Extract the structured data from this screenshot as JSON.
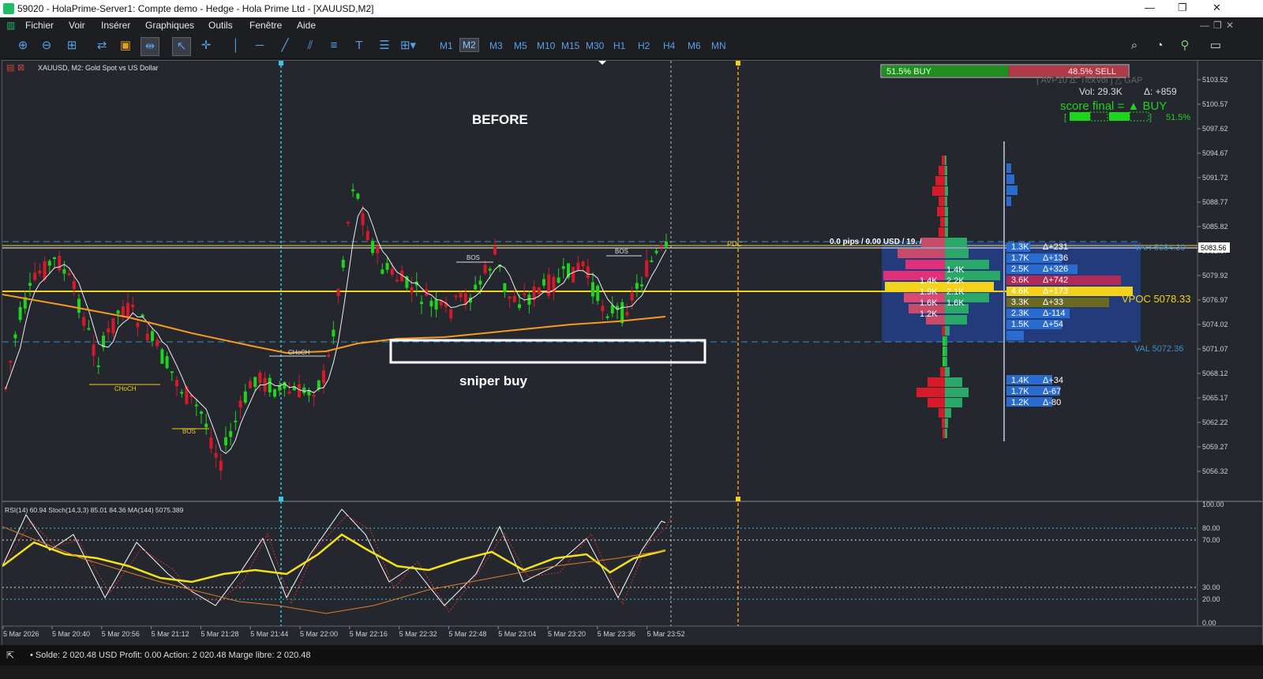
{
  "window": {
    "title": "59020 - HolaPrime-Server1: Compte demo - Hedge - Hola Prime Ltd - [XAUUSD,M2]"
  },
  "menu": [
    "Fichier",
    "Voir",
    "Insérer",
    "Graphiques",
    "Outils",
    "Fenêtre",
    "Aide"
  ],
  "timeframes": [
    "M1",
    "M2",
    "M3",
    "M5",
    "M10",
    "M15",
    "M30",
    "H1",
    "H2",
    "H4",
    "M6",
    "MN"
  ],
  "active_timeframe": "M2",
  "chart": {
    "symbol_label": "XAUUSD, M2:  Gold Spot vs US Dollar",
    "annotation_before": "BEFORE",
    "annotation_sniper": "sniper buy",
    "pips_line": "0.0 pips / 0.00 USD / 19. / 0:47:0:18",
    "pdc": "PDC",
    "markers": [
      "BOS",
      "BOS",
      "BOS",
      "CHoCH",
      "CHoCH"
    ],
    "vah": "VAH 5084.30",
    "vpoc": "VPOC 5078.33",
    "val": "VAL 5072.36",
    "current_price": "5083.56"
  },
  "price_axis": [
    "5103.52",
    "5100.57",
    "5097.62",
    "5094.67",
    "5091.72",
    "5088.77",
    "5085.82",
    "5082.87",
    "5079.92",
    "5076.97",
    "5074.02",
    "5071.07",
    "5068.12",
    "5065.17",
    "5062.22",
    "5059.27",
    "5056.32"
  ],
  "time_axis": [
    "5 Mar 2026",
    "5 Mar 20:40",
    "5 Mar 20:56",
    "5 Mar 21:12",
    "5 Mar 21:28",
    "5 Mar 21:44",
    "5 Mar 22:00",
    "5 Mar 22:16",
    "5 Mar 22:32",
    "5 Mar 22:48",
    "5 Mar 23:04",
    "5 Mar 23:20",
    "5 Mar 23:36",
    "5 Mar 23:52"
  ],
  "sentiment": {
    "buy": "51.5% BUY",
    "sell": "48.5% SELL",
    "buy_pct": 51.5
  },
  "info_panel": {
    "header": "[ AVP10  Δ: TickVol ]  △ GAP",
    "vol": "Vol: 29.3K",
    "delta": "Δ: +859",
    "score": "score final = ▲ BUY",
    "score_pct": "51.5%"
  },
  "profile_labels": [
    {
      "v": "1.3K",
      "d": "Δ+231"
    },
    {
      "v": "1.7K",
      "d": "Δ+136"
    },
    {
      "v": "2.5K",
      "d": "Δ+326"
    },
    {
      "v": "3.6K",
      "d": "Δ+742"
    },
    {
      "v": "4.6K",
      "d": "Δ+173"
    },
    {
      "v": "3.3K",
      "d": "Δ+33"
    },
    {
      "v": "2.3K",
      "d": "Δ-114"
    },
    {
      "v": "1.5K",
      "d": "Δ+54"
    },
    {
      "v": "1.4K",
      "d": "Δ+34"
    },
    {
      "v": "1.7K",
      "d": "Δ-67"
    },
    {
      "v": "1.2K",
      "d": "Δ-80"
    }
  ],
  "split_labels": [
    {
      "l": "",
      "r": "1.4K"
    },
    {
      "l": "1.4K",
      "r": "2.2K"
    },
    {
      "l": "1.9K",
      "r": "2.1K"
    },
    {
      "l": "1.6K",
      "r": "1.6K"
    },
    {
      "l": "1.2K",
      "r": ""
    }
  ],
  "indicator": {
    "label": "RSI(14) 60.94 Stoch(14,3,3) 85.01 84.36 MA(144) 5075.389",
    "levels": [
      "100.00",
      "80.00",
      "70.00",
      "30.00",
      "20.00",
      "0.00"
    ]
  },
  "status": {
    "text": "Solde: 2 020.48 USD  Profit: 0.00  Action: 2 020.48  Marge libre: 2 020.48"
  },
  "colors": {
    "background": "#24272d",
    "bull": "#1ed41e",
    "bear": "#d61a2a",
    "ma_orange": "#f59a23",
    "level_yellow": "#f2d21b",
    "buy_green": "#1f8f1f",
    "sell_red": "#b23a48"
  }
}
